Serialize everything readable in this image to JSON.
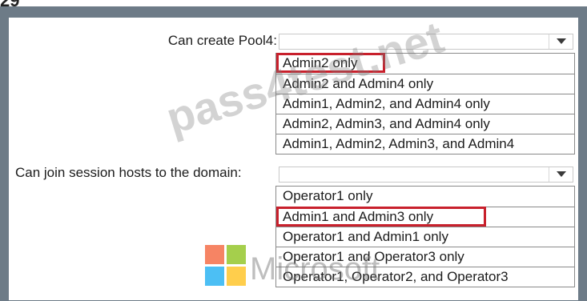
{
  "questions": [
    {
      "label": "Can create Pool4:",
      "selected": "",
      "options": [
        "Admin2 only",
        "Admin2 and Admin4 only",
        "Admin1, Admin2, and Admin4 only",
        "Admin2, Admin3, and Admin4 only",
        "Admin1, Admin2, Admin3, and Admin4"
      ],
      "highlighted_index": 0
    },
    {
      "label": "Can join session hosts to the domain:",
      "selected": "",
      "options": [
        "Operator1 only",
        "Admin1 and Admin3 only",
        "Operator1 and Admin1 only",
        "Operator1 and Operator3 only",
        "Operator1, Operator2, and Operator3"
      ],
      "highlighted_index": 1
    }
  ],
  "watermark": {
    "text": "pass4test.net"
  },
  "logo": {
    "text": "Microsoft",
    "colors": [
      "#f25022",
      "#7fba00",
      "#00a4ef",
      "#ffb900"
    ]
  },
  "colors": {
    "highlight": "#c8202c",
    "frame": "#6d7b87"
  }
}
